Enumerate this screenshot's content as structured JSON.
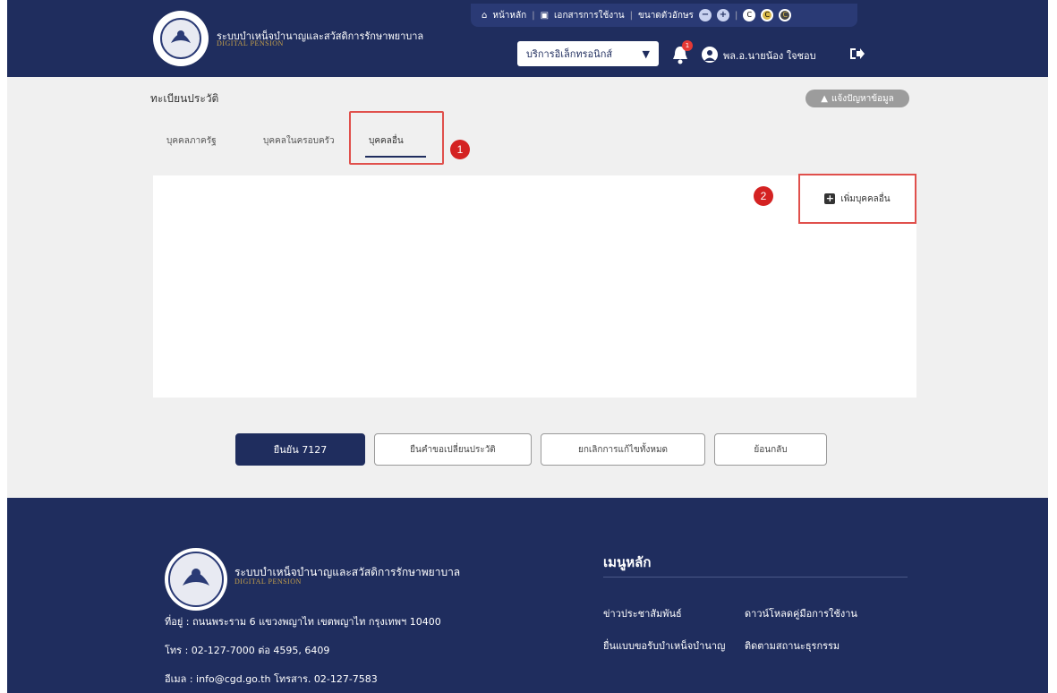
{
  "header": {
    "system_title": "ระบบบำเหน็จบำนาญและสวัสดิการรักษาพยาบาล",
    "system_subtitle": "DIGITAL PENSION",
    "toplinks": {
      "home": "หน้าหลัก",
      "manual": "เอกสารการใช้งาน",
      "font_size": "ขนาดตัวอักษร"
    },
    "services_label": "บริการอิเล็กทรอนิกส์",
    "notification_count": "1",
    "user_name": "พล.อ.นายน้อง ใจชอบ"
  },
  "page": {
    "title": "ทะเบียนประวัติ",
    "report_label": "แจ้งปัญหาข้อมูล",
    "tabs": [
      "บุคคลภาครัฐ",
      "บุคคลในครอบครัว",
      "บุคคลอื่น"
    ],
    "add_button_label": "เพิ่มบุคคลอื่น",
    "markers": [
      "1",
      "2"
    ]
  },
  "actions": {
    "submit": "ยืนยัน 7127",
    "edit": "ยืนคำขอเปลี่ยนประวัติ",
    "cancel": "ยกเลิกการแก้ไขทั้งหมด",
    "back": "ย้อนกลับ"
  },
  "footer": {
    "system_title": "ระบบบำเหน็จบำนาญและสวัสดิการรักษาพยาบาล",
    "system_subtitle": "DIGITAL PENSION",
    "address": "ที่อยู่ : ถนนพระราม 6 แขวงพญาไท เขตพญาไท กรุงเทพฯ 10400",
    "phone": "โทร : 02-127-7000 ต่อ 4595, 6409",
    "email": "อีเมล : info@cgd.go.th โทรสาร. 02-127-7583",
    "menu_title": "เมนูหลัก",
    "links": [
      "ข่าวประชาสัมพันธ์",
      "ดาวน์โหลดคู่มือการใช้งาน",
      "ยื่นแบบขอรับบำเหน็จบำนาญ",
      "ติดตามสถานะธุรกรรม"
    ]
  },
  "colors": {
    "navy": "#1f2d5e",
    "annotation_red": "#e0504c",
    "marker_red": "#d42222"
  }
}
